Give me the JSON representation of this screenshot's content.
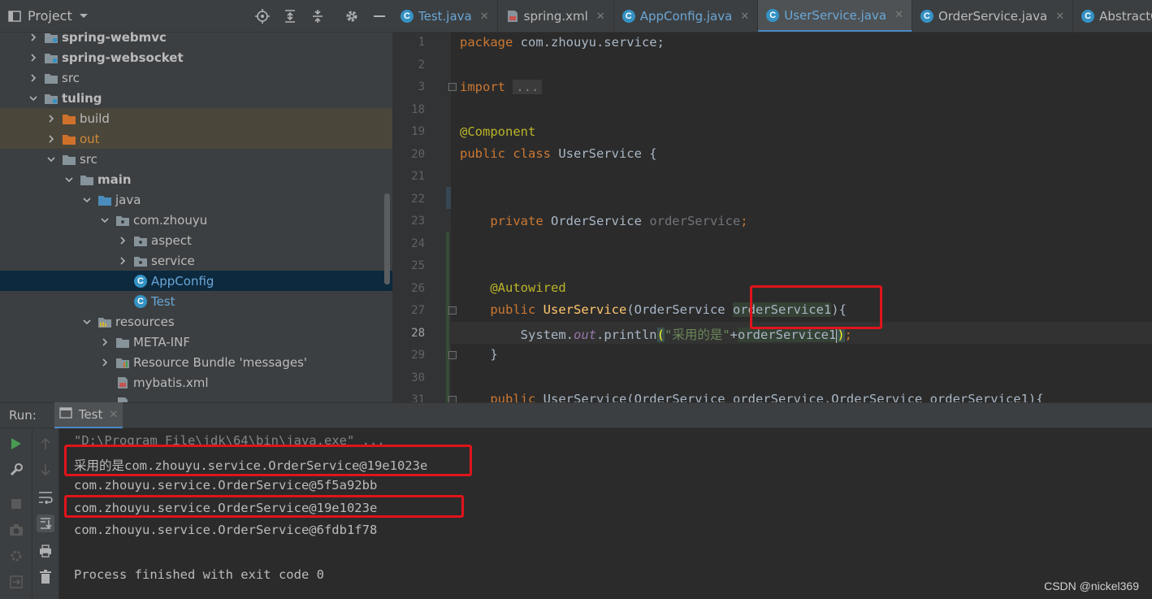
{
  "project": {
    "title": "Project",
    "toolbar_icons": [
      "locate-icon",
      "expand-all-icon",
      "collapse-all-icon",
      "gear-icon",
      "minimize-icon"
    ],
    "tree": [
      {
        "label": "spring-webmvc",
        "type": "module",
        "bold": true,
        "indent": 0,
        "arrow": "right"
      },
      {
        "label": "spring-websocket",
        "type": "module",
        "bold": true,
        "indent": 0,
        "arrow": "right"
      },
      {
        "label": "src",
        "type": "folder",
        "bold": false,
        "indent": 0,
        "arrow": "right"
      },
      {
        "label": "tuling",
        "type": "module",
        "bold": true,
        "indent": 0,
        "arrow": "down"
      },
      {
        "label": "build",
        "type": "excluded-folder",
        "bold": false,
        "indent": 1,
        "arrow": "right"
      },
      {
        "label": "out",
        "type": "excluded-folder",
        "bold": false,
        "indent": 1,
        "arrow": "right"
      },
      {
        "label": "src",
        "type": "folder",
        "bold": false,
        "indent": 1,
        "arrow": "down"
      },
      {
        "label": "main",
        "type": "folder",
        "bold": true,
        "indent": 2,
        "arrow": "down"
      },
      {
        "label": "java",
        "type": "source-folder",
        "bold": false,
        "indent": 3,
        "arrow": "down"
      },
      {
        "label": "com.zhouyu",
        "type": "package",
        "bold": false,
        "indent": 4,
        "arrow": "down"
      },
      {
        "label": "aspect",
        "type": "package",
        "bold": false,
        "indent": 5,
        "arrow": "right"
      },
      {
        "label": "service",
        "type": "package",
        "bold": false,
        "indent": 5,
        "arrow": "right"
      },
      {
        "label": "AppConfig",
        "type": "class",
        "bold": false,
        "indent": 5,
        "arrow": "none"
      },
      {
        "label": "Test",
        "type": "class-main",
        "bold": false,
        "indent": 5,
        "arrow": "none"
      },
      {
        "label": "resources",
        "type": "resources-folder",
        "bold": false,
        "indent": 3,
        "arrow": "down"
      },
      {
        "label": "META-INF",
        "type": "folder",
        "bold": false,
        "indent": 4,
        "arrow": "right"
      },
      {
        "label": "Resource Bundle 'messages'",
        "type": "bundle",
        "bold": false,
        "indent": 4,
        "arrow": "right"
      },
      {
        "label": "mybatis.xml",
        "type": "xml",
        "bold": false,
        "indent": 4,
        "arrow": "none"
      },
      {
        "label": "",
        "type": "properties",
        "bold": false,
        "indent": 4,
        "arrow": "none"
      }
    ]
  },
  "tabs": [
    {
      "label": "Test.java",
      "icon": "class-icon",
      "active": false,
      "link": true
    },
    {
      "label": "spring.xml",
      "icon": "xml-icon",
      "active": false,
      "link": false
    },
    {
      "label": "AppConfig.java",
      "icon": "class-icon",
      "active": false,
      "link": true
    },
    {
      "label": "UserService.java",
      "icon": "class-icon",
      "active": true,
      "link": true
    },
    {
      "label": "OrderService.java",
      "icon": "class-icon",
      "active": false,
      "link": false
    },
    {
      "label": "AbstractClas",
      "icon": "class-icon",
      "active": false,
      "link": false
    }
  ],
  "editor": {
    "line_numbers": [
      "1",
      "2",
      "3",
      "18",
      "19",
      "20",
      "21",
      "22",
      "23",
      "24",
      "25",
      "26",
      "27",
      "28",
      "29",
      "30",
      "31"
    ],
    "current_line": "28",
    "code": {
      "l1_kw": "package",
      "l1_rest": " com.zhouyu.service;",
      "l3_kw": "import",
      "l3_fold": "...",
      "l19_ann": "@Component",
      "l20_kw": "public class",
      "l20_rest": " UserService {",
      "l23_kw": "private",
      "l23_type": " OrderService ",
      "l23_field": "orderService",
      "l23_end": ";",
      "l26_ann": "@Autowired",
      "l27_kw": "public",
      "l27_method": " UserService",
      "l27_open": "(OrderService ",
      "l27_param": "orderService1",
      "l27_close": "){",
      "l28_sys": "System.",
      "l28_out": "out",
      "l28_println": ".println",
      "l28_lp": "(",
      "l28_str": "\"采用的是\"",
      "l28_plus": "+",
      "l28_param": "orderService1",
      "l28_rp": ")",
      "l28_semi": ";",
      "l29_brace": "}",
      "l31_kw": "public",
      "l31_rest": " UserService(OrderService orderService,OrderService orderService1){"
    }
  },
  "run": {
    "label": "Run:",
    "tab_label": "Test",
    "console": [
      "\"D:\\Program File\\jdk\\64\\bin\\java.exe\" ...",
      "采用的是com.zhouyu.service.OrderService@19e1023e",
      "com.zhouyu.service.OrderService@5f5a92bb",
      "com.zhouyu.service.OrderService@19e1023e",
      "com.zhouyu.service.OrderService@6fdb1f78",
      "",
      "Process finished with exit code 0"
    ]
  },
  "watermark": "CSDN @nickel369",
  "colors": {
    "accent": "#4a88c7",
    "highlight_box": "#e0141b",
    "keyword": "#cc7832",
    "annotation": "#bbb529",
    "method": "#ffc66d",
    "field": "#9876aa",
    "string": "#6a8759"
  }
}
